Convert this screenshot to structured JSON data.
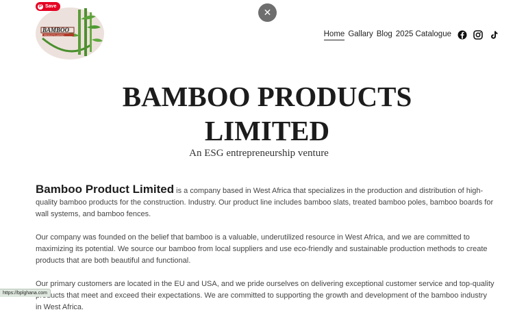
{
  "pin_save": {
    "label": "Save",
    "color": "#e60023"
  },
  "logo": {
    "text": "BAMBOO",
    "subtext": "PRODUCTS LIMITED"
  },
  "close": {
    "symbol": "✕"
  },
  "nav": {
    "items": [
      {
        "label": "Home",
        "active": true
      },
      {
        "label": "Gallary",
        "active": false
      },
      {
        "label": "Blog",
        "active": false
      },
      {
        "label": "2025 Catalogue",
        "active": false
      }
    ],
    "social": [
      "facebook-icon",
      "instagram-icon",
      "tiktok-icon"
    ]
  },
  "hero": {
    "title_line1": "BAMBOO PRODUCTS",
    "title_line2": "LIMITED",
    "subtitle": "An ESG entrepreneurship venture"
  },
  "body": {
    "lead": "Bamboo Product Limited",
    "p1": " is a company based in West Africa that specializes in the production and distribution of high-quality bamboo products for the construction. Industry. Our product line includes bamboo slats, treated bamboo poles, bamboo boards for wall systems, and bamboo fences.",
    "p2": "Our company was founded on the belief that bamboo is a valuable, underutilized resource in West Africa, and we are committed to maximizing its potential. We source our bamboo from local suppliers and use eco-friendly and sustainable production methods to create products that are both beautiful and functional.",
    "p3": "Our primary customers are located in the EU and USA, and we pride ourselves on delivering exceptional customer service and top-quality products that meet and exceed their expectations. We are committed to supporting the growth and development of the bamboo industry in West Africa."
  },
  "status_bar": {
    "url": "https://bplghana.com"
  }
}
